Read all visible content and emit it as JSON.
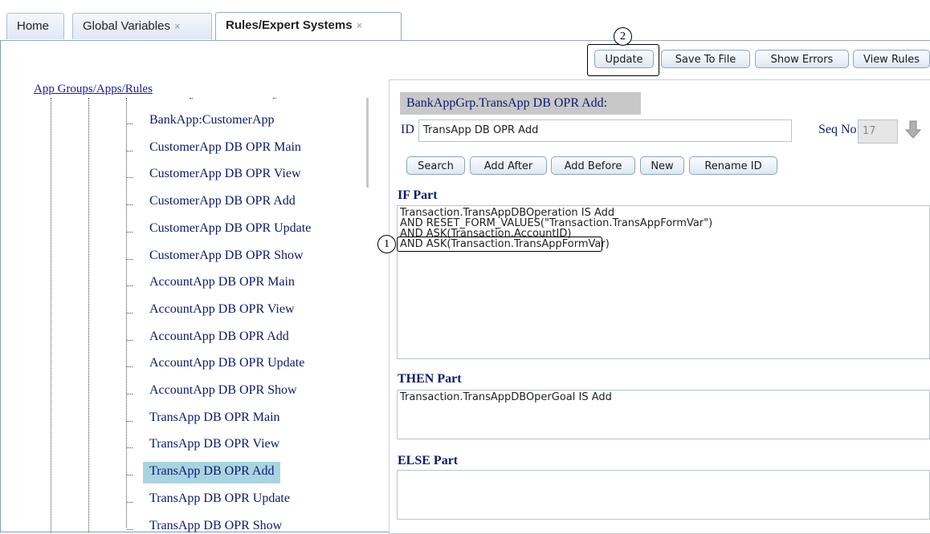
{
  "tabs": [
    {
      "label": "Home",
      "closable": false
    },
    {
      "label": "Global Variables",
      "closable": true
    },
    {
      "label": "Rules/Expert Systems",
      "closable": true,
      "active": true
    }
  ],
  "close_glyph": "×",
  "toolbar": {
    "update_label": "Update",
    "save_label": "Save To File",
    "errors_label": "Show Errors",
    "view_label": "View Rules"
  },
  "callouts": {
    "first": "1",
    "second": "2"
  },
  "tree": {
    "title": "App Groups/Apps/Rules",
    "items": [
      "BankApp:CustomerApp",
      "CustomerApp DB OPR Main",
      "CustomerApp DB OPR View",
      "CustomerApp DB OPR Add",
      "CustomerApp DB OPR Update",
      "CustomerApp DB OPR Show",
      "AccountApp DB OPR Main",
      "AccountApp DB OPR View",
      "AccountApp DB OPR Add",
      "AccountApp DB OPR Update",
      "AccountApp DB OPR Show",
      "TransApp DB OPR Main",
      "TransApp DB OPR View",
      "TransApp DB OPR Add",
      "TransApp DB OPR Update",
      "TransApp DB OPR Show"
    ],
    "selected": "TransApp DB OPR Add"
  },
  "editor": {
    "path": "BankAppGrp.TransApp DB OPR Add:",
    "id_label": "ID",
    "id_value": "TransApp DB OPR Add",
    "seq_label": "Seq No:",
    "seq_value": "17",
    "buttons": {
      "search": "Search",
      "add_after": "Add After",
      "add_before": "Add Before",
      "new": "New",
      "rename": "Rename ID"
    },
    "if_label": "IF Part",
    "if_lines": [
      "Transaction.TransAppDBOperation IS Add",
      "AND RESET_FORM_VALUES(\"Transaction.TransAppFormVar\")",
      "AND ASK(Transaction.AccountID)",
      "AND ASK(Transaction.TransAppFormVar)"
    ],
    "then_label": "THEN Part",
    "then_lines": [
      "Transaction.TransAppDBOperGoal IS Add"
    ],
    "else_label": "ELSE Part",
    "else_lines": []
  },
  "icons": {
    "move_down": "down-arrow-icon",
    "close": "close-icon"
  },
  "colors": {
    "selected_row": "#a8d4e0",
    "label_text": "#0b1a6e",
    "tab_border": "#8fa9cf"
  }
}
